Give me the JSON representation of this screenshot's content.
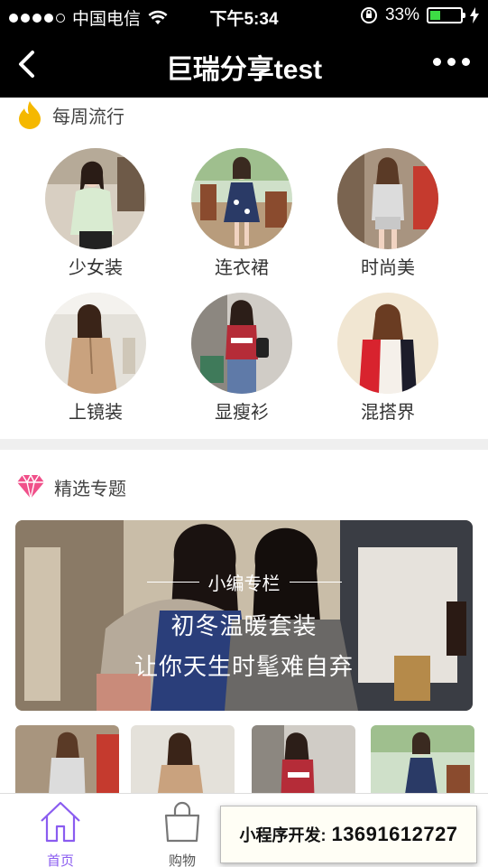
{
  "status_bar": {
    "carrier": "中国电信",
    "time": "下午5:34",
    "battery_percent": "33%",
    "battery_level": 0.33
  },
  "nav": {
    "title": "巨瑞分享test"
  },
  "weekly": {
    "title": "每周流行",
    "categories": [
      {
        "label": "少女装"
      },
      {
        "label": "连衣裙"
      },
      {
        "label": "时尚美"
      },
      {
        "label": "上镜装"
      },
      {
        "label": "显瘦衫"
      },
      {
        "label": "混搭界"
      }
    ]
  },
  "topics": {
    "title": "精选专题",
    "banner": {
      "kicker": "小编专栏",
      "line1": "初冬温暖套装",
      "line2": "让你天生时髦难自弃"
    }
  },
  "tab_bar": {
    "tabs": [
      {
        "label": "首页",
        "icon": "home-icon",
        "active": true
      },
      {
        "label": "购物",
        "icon": "shopping-bag-icon",
        "active": false
      }
    ]
  },
  "overlay": {
    "label": "小程序开发:",
    "phone": "13691612727"
  },
  "colors": {
    "accent": "#8a5cf0",
    "flame": "#f5b800",
    "diamond": "#f0508a"
  }
}
